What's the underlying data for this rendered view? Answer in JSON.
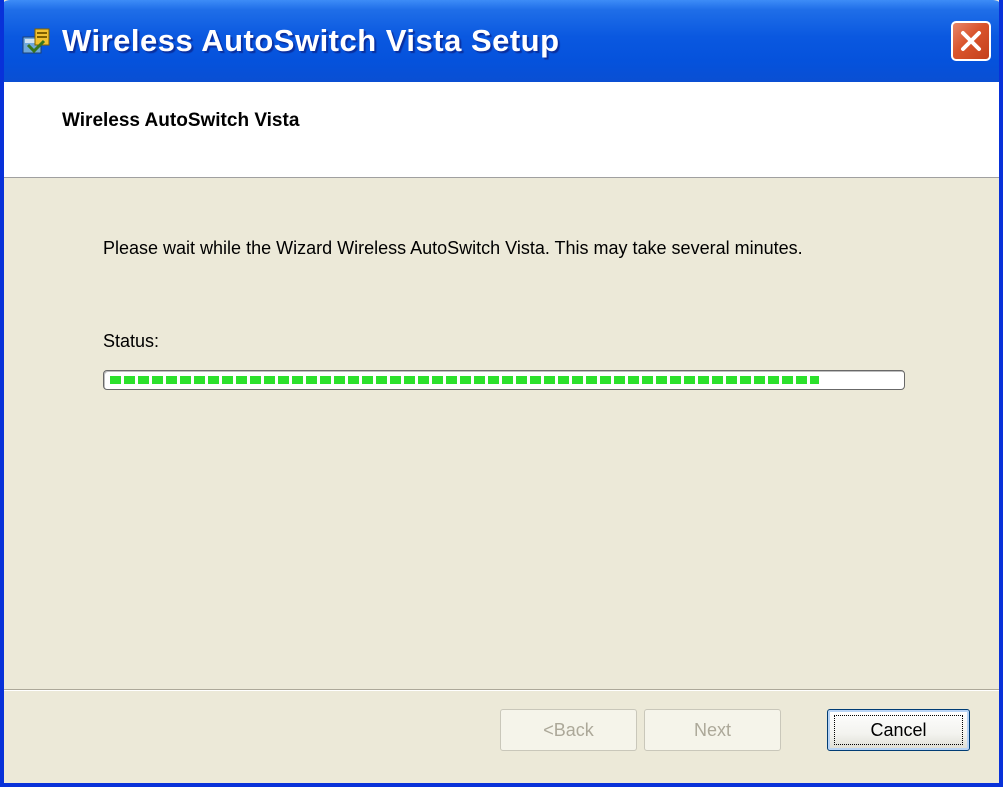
{
  "window": {
    "title": "Wireless AutoSwitch Vista Setup",
    "close_icon": "close-icon",
    "app_icon": "setup-installer-icon"
  },
  "banner": {
    "title": "Wireless AutoSwitch Vista"
  },
  "content": {
    "description": "Please wait while the Wizard  Wireless AutoSwitch Vista.  This may take several minutes.",
    "status_label": "Status:",
    "progress_fraction": 0.9
  },
  "buttons": {
    "back": "<Back",
    "next": "Next",
    "cancel": "Cancel"
  },
  "colors": {
    "titlebar": "#0a58e0",
    "window_border": "#0831d9",
    "dialog_bg": "#ece9d8",
    "progress_green": "#2ce12c",
    "close_red": "#d9542c"
  }
}
